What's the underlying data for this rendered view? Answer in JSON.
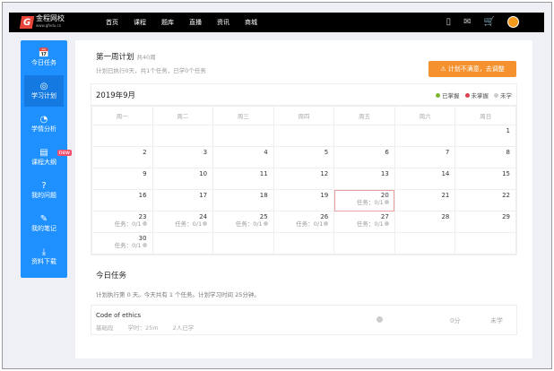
{
  "header": {
    "logo_text": "金程网校",
    "logo_sub": "www.gfedu.cn",
    "nav": [
      "首页",
      "课程",
      "题库",
      "直播",
      "资讯",
      "商城"
    ]
  },
  "sidebar": {
    "items": [
      {
        "label": "今日任务",
        "icon": "calendar-icon",
        "glyph": "📅"
      },
      {
        "label": "学习计划",
        "icon": "target-icon",
        "glyph": "◎",
        "active": true
      },
      {
        "label": "学情分析",
        "icon": "chart-icon",
        "glyph": "◔"
      },
      {
        "label": "课程大纲",
        "icon": "notebook-icon",
        "glyph": "▤",
        "badge": "new"
      },
      {
        "label": "我的问题",
        "icon": "question-icon",
        "glyph": "?"
      },
      {
        "label": "我的笔记",
        "icon": "pencil-icon",
        "glyph": "✎"
      },
      {
        "label": "资料下载",
        "icon": "download-icon",
        "glyph": "⤓"
      }
    ]
  },
  "plan": {
    "title": "第一周计划",
    "total": "共40周",
    "summary": "计划已执行0天，共1个任务，已学0个任务",
    "adjust_button": "计划不满意，去调整"
  },
  "calendar": {
    "month": "2019年9月",
    "legend": [
      {
        "label": "已掌握",
        "color": "#7cb82f"
      },
      {
        "label": "未掌握",
        "color": "#e04050"
      },
      {
        "label": "未学",
        "color": "#cccccc"
      }
    ],
    "weekdays": [
      "周一",
      "周二",
      "周三",
      "周四",
      "周五",
      "周六",
      "周日"
    ],
    "today": 20,
    "task_label": "任务：0/1",
    "task_days": [
      20,
      23,
      24,
      25,
      26,
      27,
      30
    ],
    "weeks": [
      [
        null,
        null,
        null,
        null,
        null,
        null,
        1
      ],
      [
        2,
        3,
        4,
        5,
        6,
        7,
        8
      ],
      [
        9,
        10,
        11,
        12,
        13,
        14,
        15
      ],
      [
        16,
        17,
        18,
        19,
        20,
        21,
        22
      ],
      [
        23,
        24,
        25,
        26,
        27,
        28,
        29
      ],
      [
        30,
        null,
        null,
        null,
        null,
        null,
        null
      ]
    ]
  },
  "today_tasks": {
    "title": "今日任务",
    "summary": "计划执行第 0 天。今天共有 1 个任务。计划学习时间 25分钟。",
    "items": [
      {
        "name": "Code of ethics",
        "category": "基础段",
        "hours": "学时：25m",
        "learners": "2人已学",
        "score": "0分",
        "status": "未学"
      }
    ]
  }
}
